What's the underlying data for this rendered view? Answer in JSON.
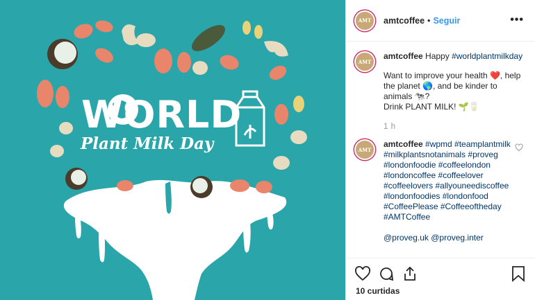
{
  "image": {
    "title": "WORLD",
    "subtitle": "Plant Milk Day",
    "colors": {
      "background": "#2aa5a9",
      "milk": "#ffffff",
      "almond": "#e8856a",
      "cashew": "#e8dcc0"
    }
  },
  "header": {
    "username": "amtcoffee",
    "separator": "•",
    "follow_label": "Seguir",
    "more_label": "•••",
    "avatar_text": "AMT"
  },
  "comments": [
    {
      "username": "amtcoffee",
      "text_prefix": "Happy ",
      "tag": "#worldplantmilkday",
      "line2": "Want to improve your health ❤️, help the planet 🌎, and be kinder to animals 🐄?",
      "line3": "Drink PLANT MILK! 🌱🥛",
      "time": "1 h"
    },
    {
      "username": "amtcoffee",
      "tags": "#wpmd #teamplantmilk #milkplantsnotanimals #proveg #londonfoodie #coffeelondon #londoncoffee #coffeelover #coffeelovers #allyouneediscoffee #londonfoodies #londonfood #CoffeePlease #Coffeeoftheday #AMTCoffee",
      "mentions": "@proveg.uk @proveg.inter"
    }
  ],
  "actions": {
    "likes": "10 curtidas",
    "icons": [
      "heart-icon",
      "comment-icon",
      "share-icon",
      "bookmark-icon"
    ]
  }
}
